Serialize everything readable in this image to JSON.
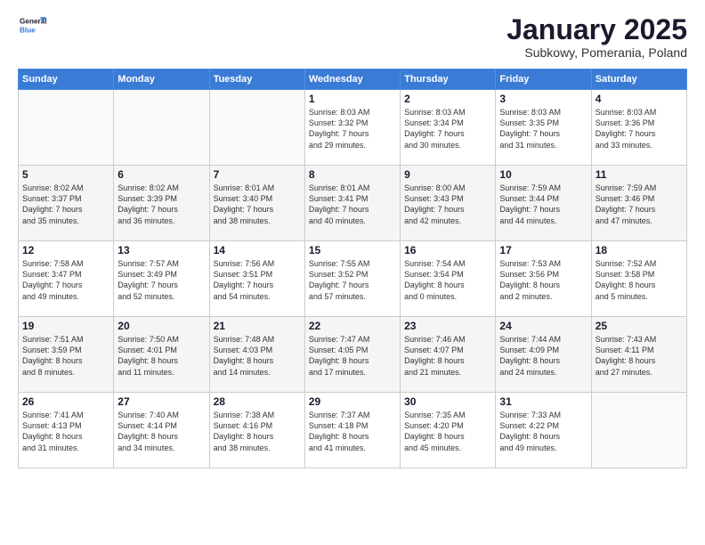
{
  "logo": {
    "line1": "General",
    "line2": "Blue"
  },
  "title": "January 2025",
  "subtitle": "Subkowy, Pomerania, Poland",
  "days_of_week": [
    "Sunday",
    "Monday",
    "Tuesday",
    "Wednesday",
    "Thursday",
    "Friday",
    "Saturday"
  ],
  "weeks": [
    [
      {
        "day": "",
        "info": ""
      },
      {
        "day": "",
        "info": ""
      },
      {
        "day": "",
        "info": ""
      },
      {
        "day": "1",
        "info": "Sunrise: 8:03 AM\nSunset: 3:32 PM\nDaylight: 7 hours\nand 29 minutes."
      },
      {
        "day": "2",
        "info": "Sunrise: 8:03 AM\nSunset: 3:34 PM\nDaylight: 7 hours\nand 30 minutes."
      },
      {
        "day": "3",
        "info": "Sunrise: 8:03 AM\nSunset: 3:35 PM\nDaylight: 7 hours\nand 31 minutes."
      },
      {
        "day": "4",
        "info": "Sunrise: 8:03 AM\nSunset: 3:36 PM\nDaylight: 7 hours\nand 33 minutes."
      }
    ],
    [
      {
        "day": "5",
        "info": "Sunrise: 8:02 AM\nSunset: 3:37 PM\nDaylight: 7 hours\nand 35 minutes."
      },
      {
        "day": "6",
        "info": "Sunrise: 8:02 AM\nSunset: 3:39 PM\nDaylight: 7 hours\nand 36 minutes."
      },
      {
        "day": "7",
        "info": "Sunrise: 8:01 AM\nSunset: 3:40 PM\nDaylight: 7 hours\nand 38 minutes."
      },
      {
        "day": "8",
        "info": "Sunrise: 8:01 AM\nSunset: 3:41 PM\nDaylight: 7 hours\nand 40 minutes."
      },
      {
        "day": "9",
        "info": "Sunrise: 8:00 AM\nSunset: 3:43 PM\nDaylight: 7 hours\nand 42 minutes."
      },
      {
        "day": "10",
        "info": "Sunrise: 7:59 AM\nSunset: 3:44 PM\nDaylight: 7 hours\nand 44 minutes."
      },
      {
        "day": "11",
        "info": "Sunrise: 7:59 AM\nSunset: 3:46 PM\nDaylight: 7 hours\nand 47 minutes."
      }
    ],
    [
      {
        "day": "12",
        "info": "Sunrise: 7:58 AM\nSunset: 3:47 PM\nDaylight: 7 hours\nand 49 minutes."
      },
      {
        "day": "13",
        "info": "Sunrise: 7:57 AM\nSunset: 3:49 PM\nDaylight: 7 hours\nand 52 minutes."
      },
      {
        "day": "14",
        "info": "Sunrise: 7:56 AM\nSunset: 3:51 PM\nDaylight: 7 hours\nand 54 minutes."
      },
      {
        "day": "15",
        "info": "Sunrise: 7:55 AM\nSunset: 3:52 PM\nDaylight: 7 hours\nand 57 minutes."
      },
      {
        "day": "16",
        "info": "Sunrise: 7:54 AM\nSunset: 3:54 PM\nDaylight: 8 hours\nand 0 minutes."
      },
      {
        "day": "17",
        "info": "Sunrise: 7:53 AM\nSunset: 3:56 PM\nDaylight: 8 hours\nand 2 minutes."
      },
      {
        "day": "18",
        "info": "Sunrise: 7:52 AM\nSunset: 3:58 PM\nDaylight: 8 hours\nand 5 minutes."
      }
    ],
    [
      {
        "day": "19",
        "info": "Sunrise: 7:51 AM\nSunset: 3:59 PM\nDaylight: 8 hours\nand 8 minutes."
      },
      {
        "day": "20",
        "info": "Sunrise: 7:50 AM\nSunset: 4:01 PM\nDaylight: 8 hours\nand 11 minutes."
      },
      {
        "day": "21",
        "info": "Sunrise: 7:48 AM\nSunset: 4:03 PM\nDaylight: 8 hours\nand 14 minutes."
      },
      {
        "day": "22",
        "info": "Sunrise: 7:47 AM\nSunset: 4:05 PM\nDaylight: 8 hours\nand 17 minutes."
      },
      {
        "day": "23",
        "info": "Sunrise: 7:46 AM\nSunset: 4:07 PM\nDaylight: 8 hours\nand 21 minutes."
      },
      {
        "day": "24",
        "info": "Sunrise: 7:44 AM\nSunset: 4:09 PM\nDaylight: 8 hours\nand 24 minutes."
      },
      {
        "day": "25",
        "info": "Sunrise: 7:43 AM\nSunset: 4:11 PM\nDaylight: 8 hours\nand 27 minutes."
      }
    ],
    [
      {
        "day": "26",
        "info": "Sunrise: 7:41 AM\nSunset: 4:13 PM\nDaylight: 8 hours\nand 31 minutes."
      },
      {
        "day": "27",
        "info": "Sunrise: 7:40 AM\nSunset: 4:14 PM\nDaylight: 8 hours\nand 34 minutes."
      },
      {
        "day": "28",
        "info": "Sunrise: 7:38 AM\nSunset: 4:16 PM\nDaylight: 8 hours\nand 38 minutes."
      },
      {
        "day": "29",
        "info": "Sunrise: 7:37 AM\nSunset: 4:18 PM\nDaylight: 8 hours\nand 41 minutes."
      },
      {
        "day": "30",
        "info": "Sunrise: 7:35 AM\nSunset: 4:20 PM\nDaylight: 8 hours\nand 45 minutes."
      },
      {
        "day": "31",
        "info": "Sunrise: 7:33 AM\nSunset: 4:22 PM\nDaylight: 8 hours\nand 49 minutes."
      },
      {
        "day": "",
        "info": ""
      }
    ]
  ]
}
